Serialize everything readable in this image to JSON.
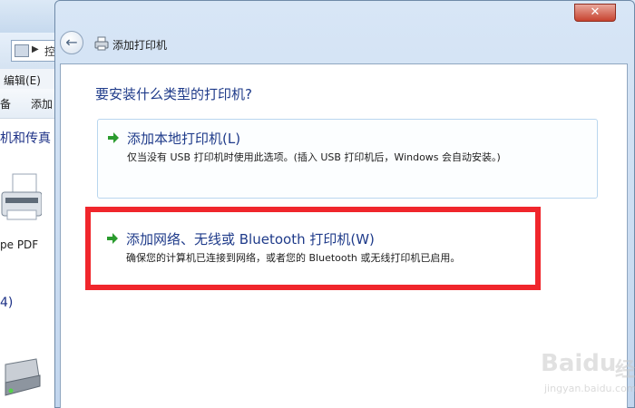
{
  "background_window": {
    "address_text": "控",
    "menu_edit": "编辑(E)",
    "toolbar_item_1": "备",
    "toolbar_item_2": "添加",
    "group_label_1": "机和传真 (",
    "printer_label": "pe PDF",
    "group_label_2": "4)"
  },
  "dialog": {
    "window_title": "添加打印机",
    "close_symbol": "✕",
    "back_symbol": "←",
    "question": "要安装什么类型的打印机?",
    "options": [
      {
        "title": "添加本地打印机(L)",
        "description": "仅当没有 USB 打印机时使用此选项。(插入 USB 打印机后，Windows 会自动安装。)"
      },
      {
        "title": "添加网络、无线或 Bluetooth 打印机(W)",
        "description": "确保您的计算机已连接到网络，或者您的 Bluetooth 或无线打印机已启用。"
      }
    ]
  },
  "watermark": {
    "logo": "Baidu",
    "cn": "经验",
    "url": "jingyan.baidu.com"
  },
  "colors": {
    "accent_blue": "#1f3b8a",
    "highlight_red": "#f0262c",
    "arrow_green": "#2a9b2e"
  }
}
